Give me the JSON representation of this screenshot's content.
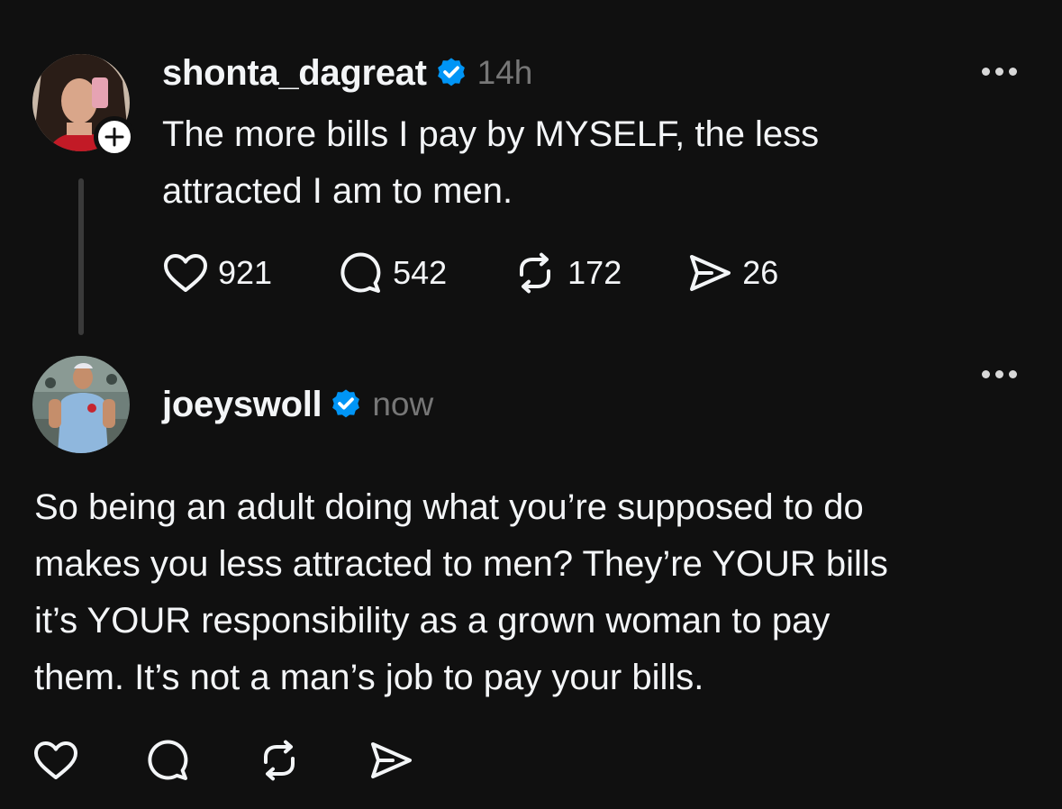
{
  "post": {
    "username": "shonta_dagreat",
    "timestamp": "14h",
    "text": "The more bills I pay by MYSELF, the less\nattracted I am to men.",
    "likes": "921",
    "comments": "542",
    "reposts": "172",
    "shares": "26"
  },
  "reply": {
    "username": "joeyswoll",
    "timestamp": "now",
    "text": "So being an adult doing what you’re supposed to do\nmakes you less attracted to men? They’re YOUR bills\nit’s YOUR responsibility as a grown woman to pay\nthem. It’s not a man’s job to pay your bills."
  },
  "colors": {
    "background": "#101010",
    "verified": "#0095f6",
    "muted": "#777777",
    "text": "#f3f5f7"
  },
  "icons": [
    "heart-icon",
    "comment-icon",
    "repost-icon",
    "share-icon",
    "verified-icon",
    "more-icon",
    "follow-plus-icon"
  ]
}
